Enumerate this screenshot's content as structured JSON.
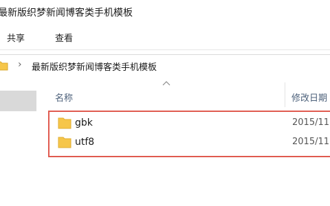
{
  "window": {
    "title": "最新版织梦新闻博客类手机模板"
  },
  "ribbon": {
    "tabs": [
      "共享",
      "查看"
    ]
  },
  "address_bar": {
    "path": "最新版织梦新闻博客类手机模板"
  },
  "file_list": {
    "columns": {
      "name": "名称",
      "date_modified": "修改日期"
    },
    "items": [
      {
        "name": "gbk",
        "date": "2015/11",
        "icon": "folder-icon"
      },
      {
        "name": "utf8",
        "date": "2015/11",
        "icon": "folder-icon"
      }
    ]
  },
  "colors": {
    "folder": "#f6c64a",
    "highlight_border": "#e05a4f",
    "column_header": "#4c607a",
    "nav_selected": "#d9d9d9"
  }
}
